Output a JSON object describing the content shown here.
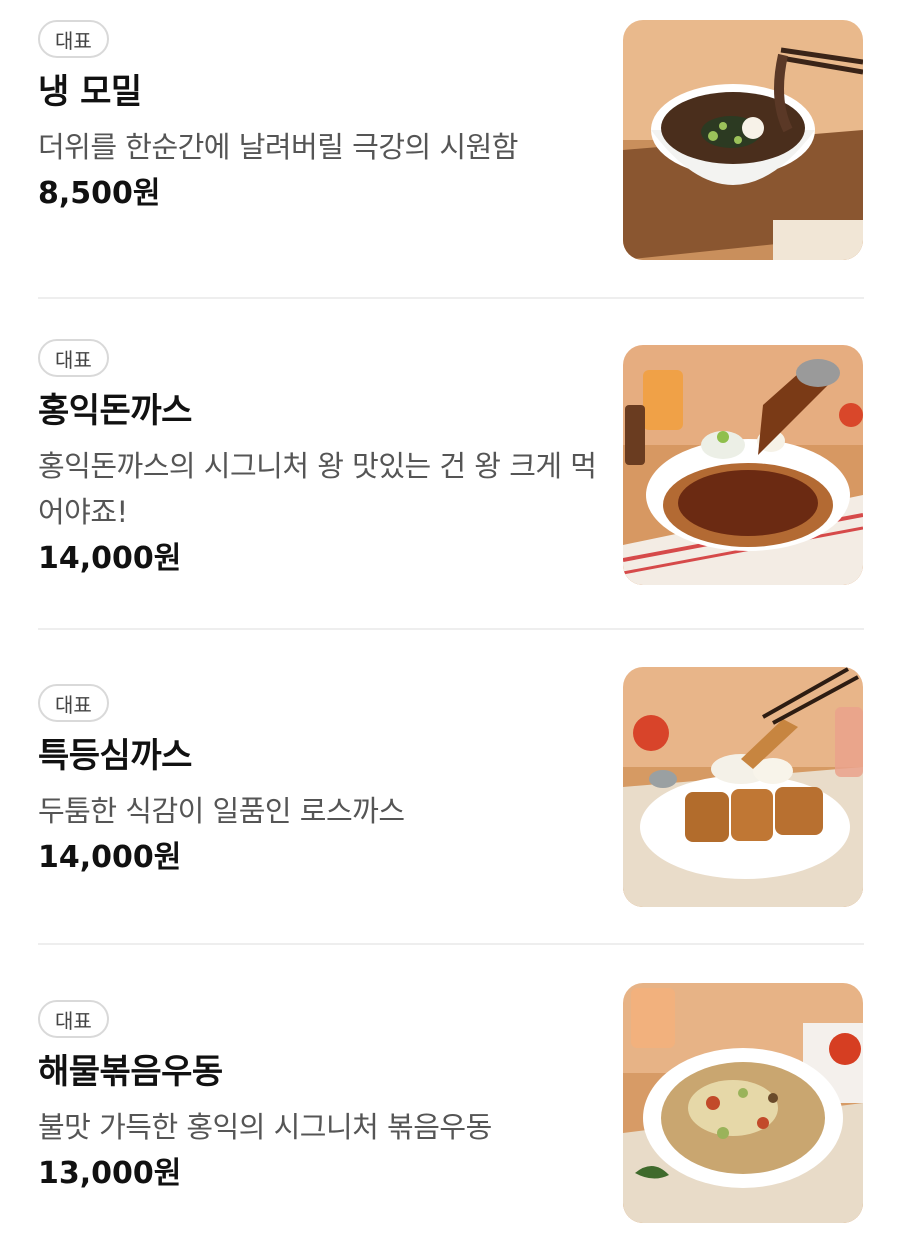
{
  "menu": {
    "items": [
      {
        "badge": "대표",
        "name": "냉 모밀",
        "description": "더위를 한순간에 날려버릴 극강의 시원함",
        "price": "8,500원",
        "image": "cold-soba-photo"
      },
      {
        "badge": "대표",
        "name": "홍익돈까스",
        "description": "홍익돈까스의 시그니처 왕 맛있는 건 왕 크게 먹어야죠!",
        "price": "14,000원",
        "image": "pork-cutlet-with-sauce-photo"
      },
      {
        "badge": "대표",
        "name": "특등심까스",
        "description": "두툼한 식감이 일품인 로스까스",
        "price": "14,000원",
        "image": "pork-loin-cutlet-photo"
      },
      {
        "badge": "대표",
        "name": "해물볶음우동",
        "description": "불맛 가득한 홍익의 시그니처 볶음우동",
        "price": "13,000원",
        "image": "seafood-stir-fried-udon-photo"
      }
    ]
  }
}
